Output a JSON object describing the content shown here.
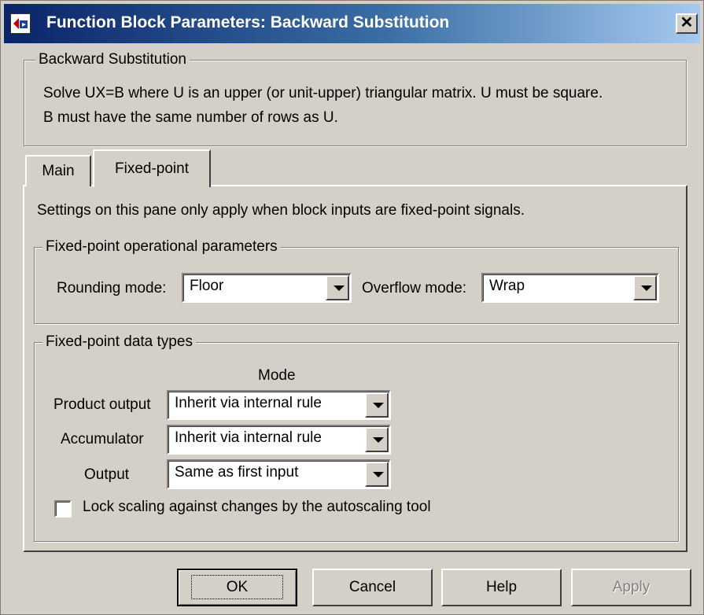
{
  "window": {
    "title": "Function Block Parameters: Backward Substitution",
    "close_glyph": "✕"
  },
  "description": {
    "group_title": "Backward Substitution",
    "line1": "Solve UX=B where U is an upper (or unit-upper) triangular matrix.  U must be square.",
    "line2": "B must have the same number of rows as U."
  },
  "tabs": [
    {
      "label": "Main",
      "active": false
    },
    {
      "label": "Fixed-point",
      "active": true
    }
  ],
  "pane": {
    "note": "Settings on this pane only apply when block inputs are fixed-point signals.",
    "operational": {
      "group_title": "Fixed-point operational parameters",
      "rounding_label": "Rounding mode:",
      "rounding_value": "Floor",
      "overflow_label": "Overflow mode:",
      "overflow_value": "Wrap"
    },
    "datatypes": {
      "group_title": "Fixed-point data types",
      "mode_header": "Mode",
      "rows": [
        {
          "label": "Product output",
          "value": "Inherit via internal rule"
        },
        {
          "label": "Accumulator",
          "value": "Inherit via internal rule"
        },
        {
          "label": "Output",
          "value": "Same as first input"
        }
      ],
      "lock_label": "Lock scaling against changes by the autoscaling tool",
      "lock_checked": false
    }
  },
  "buttons": {
    "ok": "OK",
    "cancel": "Cancel",
    "help": "Help",
    "apply": "Apply"
  },
  "icons": {
    "app": "simulink-block-icon",
    "close": "close-icon",
    "dropdown": "chevron-down-icon"
  }
}
